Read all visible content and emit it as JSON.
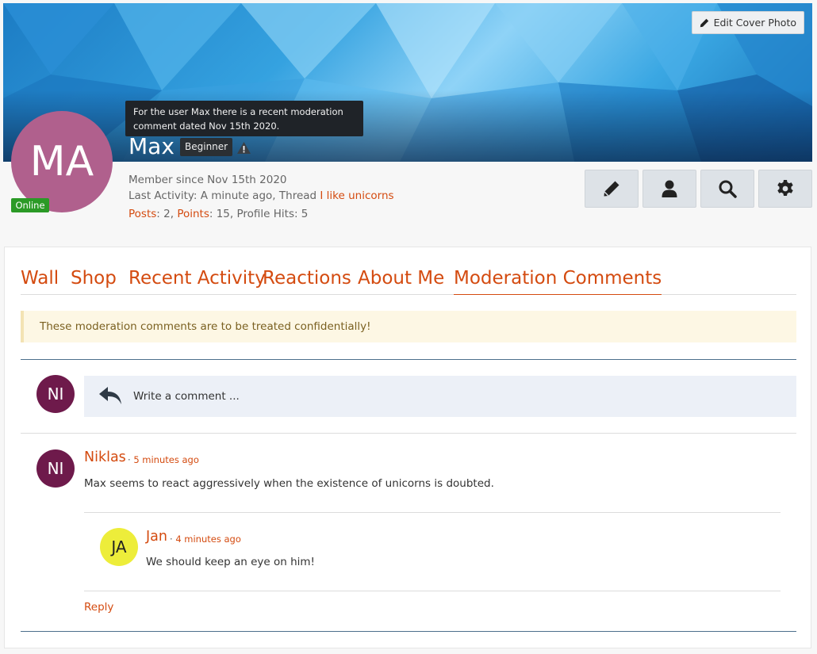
{
  "cover": {
    "edit_label": "Edit Cover Photo"
  },
  "profile": {
    "initials": "MA",
    "name": "Max",
    "rank": "Beginner",
    "online": "Online",
    "tooltip": "For the user Max there is a recent moderation comment dated Nov 15th 2020.",
    "member_since": "Member since Nov 15th 2020",
    "last_activity_prefix": "Last Activity: A minute ago,",
    "thread_prefix": "Thread",
    "thread_link": "I like unicorns",
    "posts_label": "Posts",
    "posts_value": ": 2,",
    "points_label": "Points",
    "points_value": ": 15, Profile Hits: 5"
  },
  "actions": [
    "pencil-icon",
    "user-icon",
    "search-icon",
    "gear-icon"
  ],
  "tabs": [
    "Wall",
    "Shop",
    "Recent Activity",
    "Reactions",
    "About Me",
    "Moderation Comments"
  ],
  "active_tab": "Moderation Comments",
  "notice": "These moderation comments are to be treated confidentially!",
  "composer": {
    "initials": "NI",
    "placeholder": "Write a comment ..."
  },
  "comments": [
    {
      "initials": "NI",
      "author": "Niklas",
      "time": "5 minutes ago",
      "text": "Max seems to react aggressively when the existence of unicorns is doubted.",
      "replies": [
        {
          "initials": "JA",
          "author": "Jan",
          "time": "4 minutes ago",
          "text": "We should keep an eye on him!"
        }
      ],
      "reply_label": "Reply"
    }
  ],
  "colors": {
    "accent": "#d44b10",
    "avatar_max": "#b0608d",
    "avatar_niklas": "#6e1a4b",
    "avatar_jan": "#eded3a",
    "online": "#2b9a26"
  }
}
